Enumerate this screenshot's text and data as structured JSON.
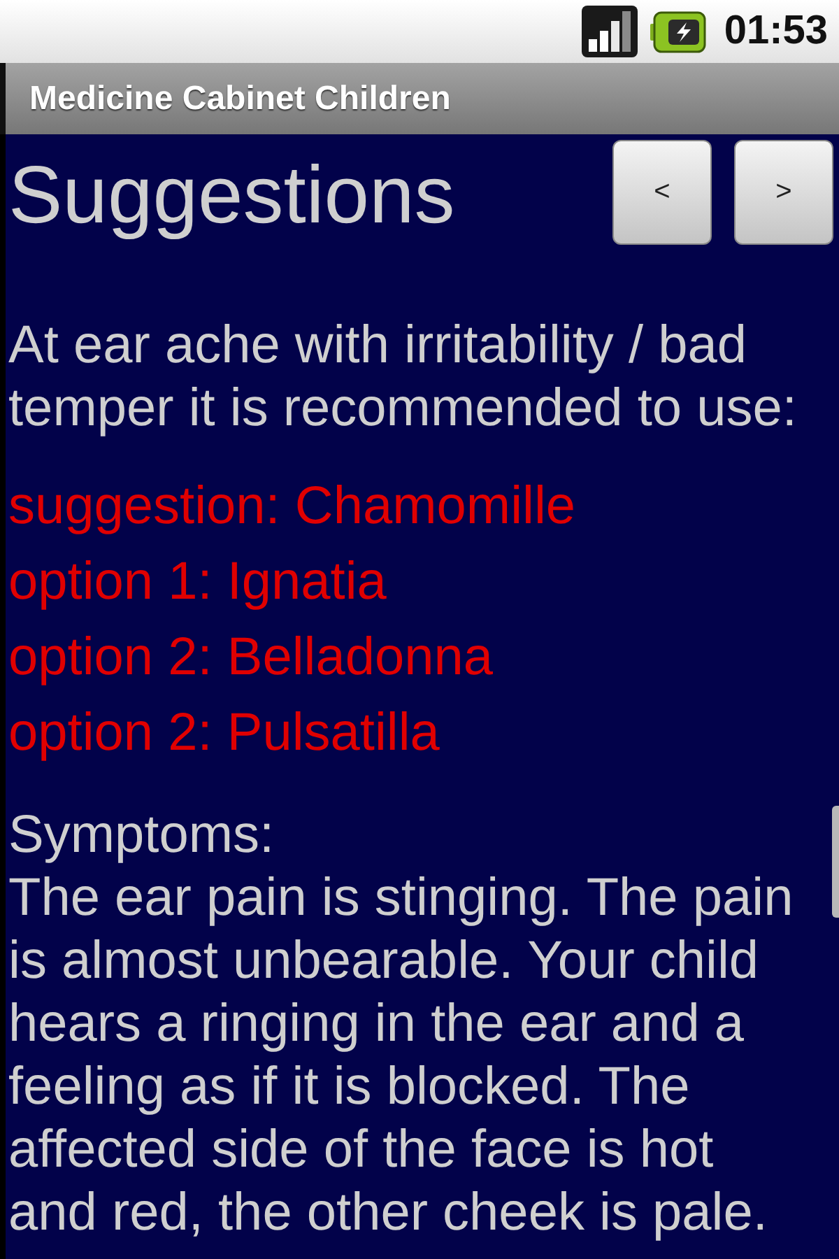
{
  "status_bar": {
    "time": "01:53"
  },
  "title_bar": {
    "title": "Medicine Cabinet Children"
  },
  "header": {
    "title": "Suggestions",
    "buttons": [
      {
        "label": "<"
      },
      {
        "label": ">"
      }
    ]
  },
  "intro": "At ear ache with irritability / bad temper it is recommended to use:",
  "remedies": [
    "suggestion: Chamomille",
    "option 1: Ignatia",
    "option 2: Belladonna",
    "option 2: Pulsatilla"
  ],
  "symptoms": {
    "heading": "Symptoms:",
    "text": "The ear pain is stinging. The pain is almost unbearable. Your child hears a ringing in the ear and a feeling as if it is blocked. The affected side of the face is hot and red, the other cheek is pale."
  }
}
